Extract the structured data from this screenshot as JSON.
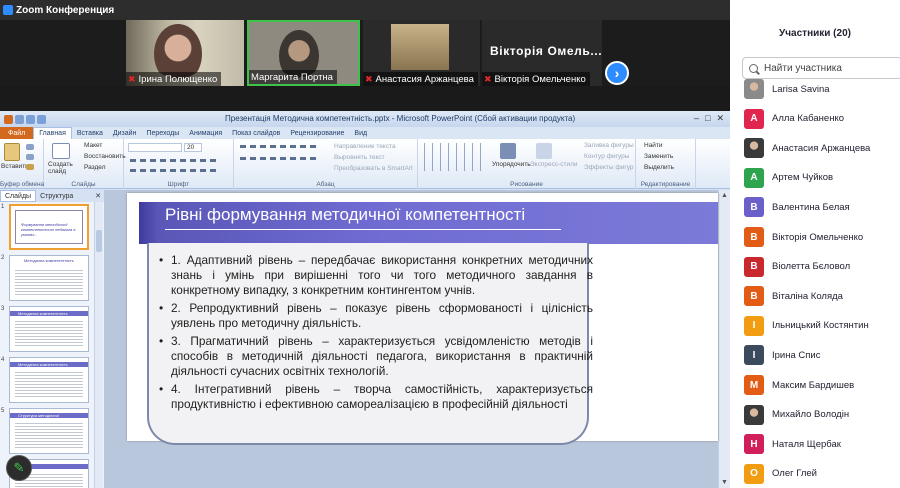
{
  "zoom": {
    "window_title": "Zoom Конференция",
    "video_tiles": [
      {
        "name": "Ірина Полющенко"
      },
      {
        "name": "Маргарита Портна"
      },
      {
        "name": "Анастасия Аржанцева"
      },
      {
        "name": "Вікторія Омельченко",
        "display_name": "Вікторія Омель..."
      }
    ],
    "next_icon": "chevron-right-icon"
  },
  "ppt": {
    "title": "Презентація Методична компетентність.pptx - Microsoft PowerPoint (Сбой активации продукта)",
    "tabs": [
      "Файл",
      "Главная",
      "Вставка",
      "Дизайн",
      "Переходы",
      "Анимация",
      "Показ слайдов",
      "Рецензирование",
      "Вид"
    ],
    "ribbon": {
      "groups": [
        "Буфер обмена",
        "Слайды",
        "Шрифт",
        "Абзац",
        "Рисование",
        "Редактирование"
      ],
      "paste": "Вставить",
      "new_slide": "Создать слайд",
      "layout": "Макет",
      "reset": "Восстановить",
      "section": "Раздел",
      "font_size": "20",
      "text_direction": "Направление текста",
      "align_text": "Выровнять текст",
      "smartart": "Преобразовать в SmartArt",
      "arrange": "Упорядочить",
      "quick_styles": "Экспресс-стили",
      "shape_fill": "Заливка фигуры",
      "shape_outline": "Контур фигуры",
      "shape_effects": "Эффекты фигур",
      "find": "Найти",
      "replace": "Заменить",
      "select": "Выделить"
    },
    "pane_tabs": [
      "Слайды",
      "Структура"
    ],
    "thumb_numbers": [
      "1",
      "2",
      "3",
      "4",
      "5"
    ],
    "thumb_titles": [
      "Формування методичної компетентності педагога в умовах...",
      "Методична компетентність",
      "Методична компетентність",
      "Методична компетентність",
      "Структура методичної компетентності"
    ]
  },
  "slide": {
    "title": "Рівні формування методичної компетентності",
    "bullets": [
      "1. Адаптивний рівень – передбачає використання конкретних методичних знань і умінь при вирішенні того чи того методичного завдання в конкретному випадку, з конкретним контингентом учнів.",
      "2. Репродуктивний рівень – показує рівень сформованості і цілісність уявлень про методичну діяльність.",
      "3. Прагматичний рівень – характеризується усвідомленістю методів і способів в методичній діяльності педагога, використання в практичній діяльності сучасних освітніх технологій.",
      "4. Інтегративний рівень – творча самостійність, характеризується продуктивністю і ефективною самореалізацією в професійній діяльності"
    ]
  },
  "participants": {
    "title": "Участники (20)",
    "search_placeholder": "Найти участника",
    "list": [
      {
        "initial": "",
        "name": "Larisa Savina",
        "color": "#8a8a8a",
        "photo": true
      },
      {
        "initial": "А",
        "name": "Алла Кабаненко",
        "color": "#e0264e"
      },
      {
        "initial": "",
        "name": "Анастасия Аржанцева",
        "color": "#3a3a3a",
        "photo": true
      },
      {
        "initial": "А",
        "name": "Артем Чуйков",
        "color": "#2ea44f"
      },
      {
        "initial": "В",
        "name": "Валентина Белая",
        "color": "#6b5fc9"
      },
      {
        "initial": "В",
        "name": "Вікторія Омельченко",
        "color": "#e25c16"
      },
      {
        "initial": "В",
        "name": "Віолетта Бєловол",
        "color": "#c8282e"
      },
      {
        "initial": "В",
        "name": "Віталіна Коляда",
        "color": "#e25c16"
      },
      {
        "initial": "І",
        "name": "Ільницький Костянтин",
        "color": "#f29c11"
      },
      {
        "initial": "І",
        "name": "Ірина Спис",
        "color": "#3b4a5c"
      },
      {
        "initial": "М",
        "name": "Максим Бардишев",
        "color": "#e25c16"
      },
      {
        "initial": "",
        "name": "Михайло Володін",
        "color": "#3a3a3a",
        "photo": true
      },
      {
        "initial": "Н",
        "name": "Наталя Щербак",
        "color": "#d11f5a"
      },
      {
        "initial": "О",
        "name": "Олег Глей",
        "color": "#f29c11"
      }
    ]
  },
  "annotate_icon": "pen-icon"
}
